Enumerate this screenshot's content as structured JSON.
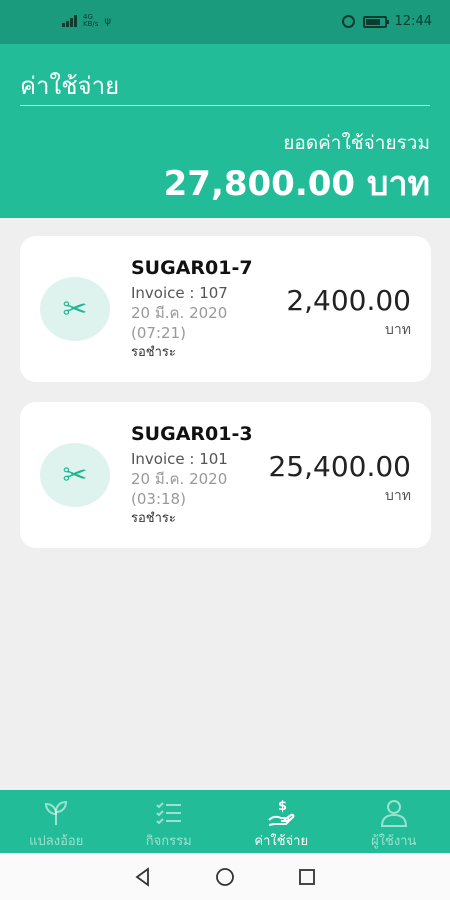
{
  "status_bar": {
    "network": "4G",
    "network_sub": "KB/s",
    "time": "12:44"
  },
  "header": {
    "title": "ค่าใช้จ่าย",
    "total_label": "ยอดค่าใช้จ่ายรวม",
    "total_amount": "27,800.00 บาท"
  },
  "expenses": [
    {
      "name": "SUGAR01-7",
      "invoice": "Invoice : 107",
      "date": "20 มี.ค. 2020",
      "time": "(07:21)",
      "status": "รอชำระ",
      "amount": "2,400.00",
      "unit": "บาท",
      "icon": "scissors-icon"
    },
    {
      "name": "SUGAR01-3",
      "invoice": "Invoice : 101",
      "date": "20 มี.ค. 2020",
      "time": "(03:18)",
      "status": "รอชำระ",
      "amount": "25,400.00",
      "unit": "บาท",
      "icon": "scissors-icon"
    }
  ],
  "bottom_nav": {
    "items": [
      {
        "label": "แปลงอ้อย",
        "icon": "sprout-icon",
        "active": false
      },
      {
        "label": "กิจกรรม",
        "icon": "checklist-icon",
        "active": false
      },
      {
        "label": "ค่าใช้จ่าย",
        "icon": "money-hand-icon",
        "active": true
      },
      {
        "label": "ผู้ใช้งาน",
        "icon": "user-icon",
        "active": false
      }
    ]
  },
  "colors": {
    "primary": "#22bc98",
    "status_bar": "#1a9b7e",
    "background": "#efefef",
    "icon_bg": "#dff3ee"
  }
}
